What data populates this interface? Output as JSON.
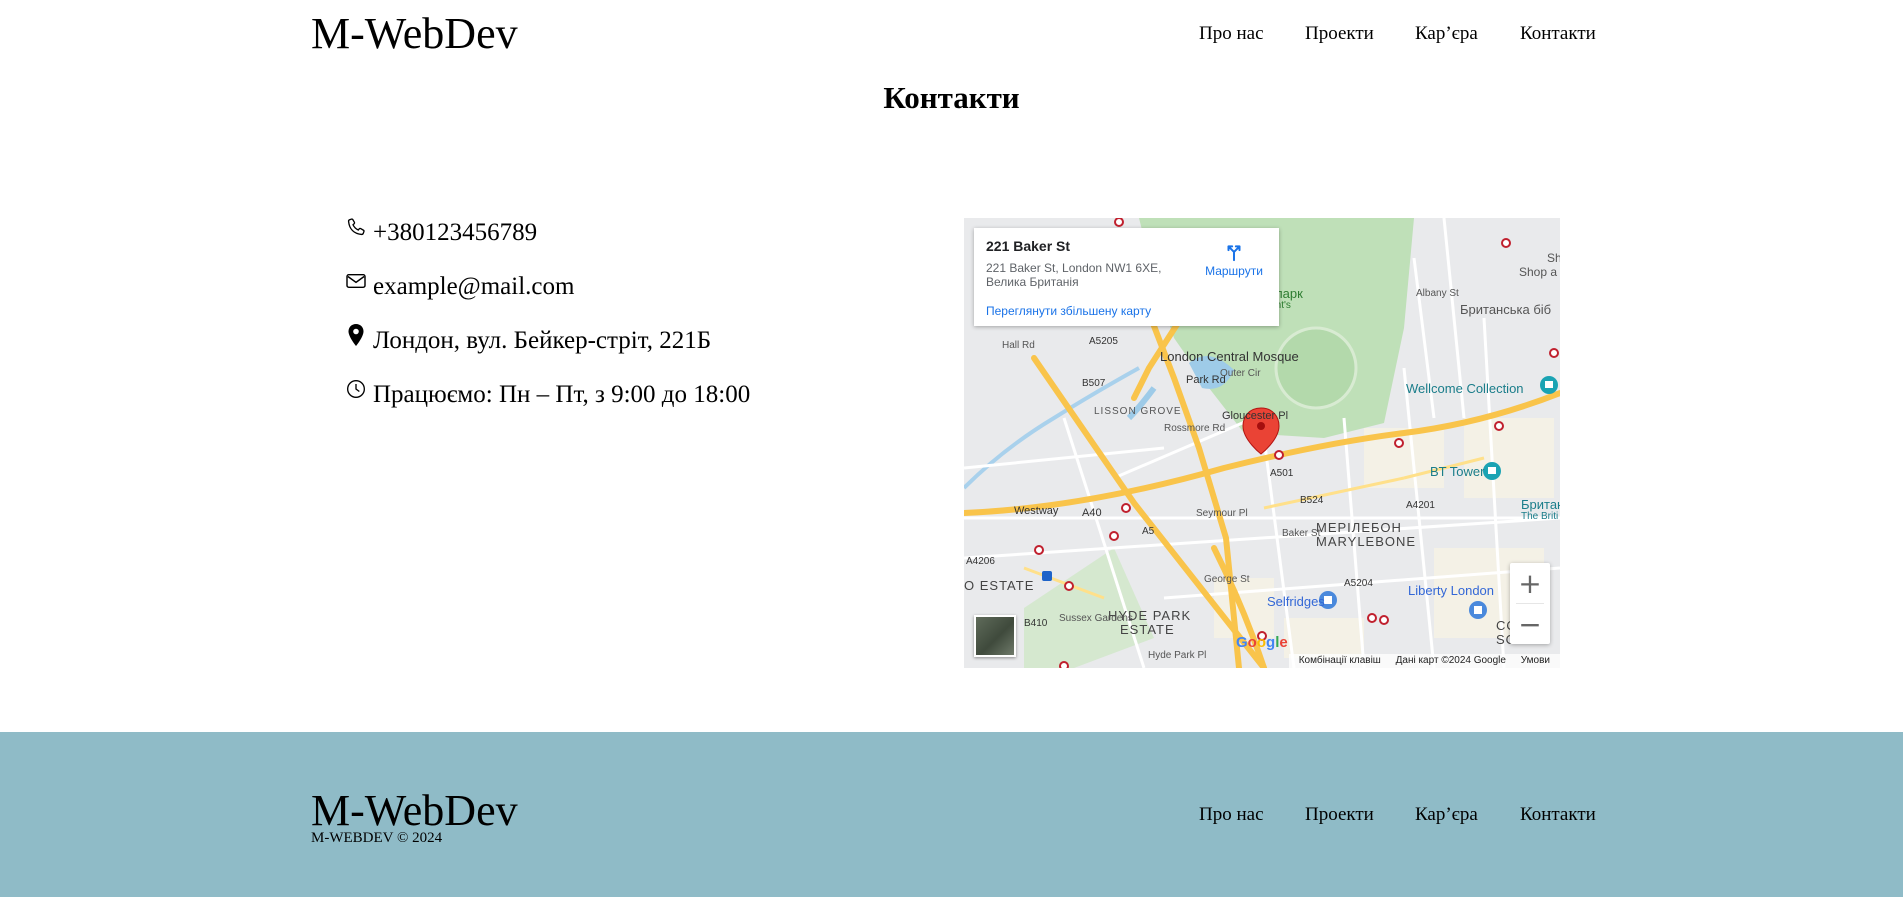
{
  "header": {
    "logo": "M-WebDev",
    "nav": [
      "Про нас",
      "Проекти",
      "Кар’єра",
      "Контакти"
    ]
  },
  "page": {
    "title": "Контакти"
  },
  "contacts": {
    "phone": "+380123456789",
    "email": "example@mail.com",
    "address": "Лондон, вул. Бейкер-стріт, 221Б",
    "hours": "Працюємо: Пн – Пт, з 9:00 до 18:00"
  },
  "map": {
    "card_title": "221 Baker St",
    "card_address": "221 Baker St, London NW1 6XE, Велика Британія",
    "directions_label": "Маршрути",
    "larger_map_link": "Переглянути збільшену карту",
    "zoom_in": "+",
    "zoom_out": "−",
    "google_logo": "Google",
    "shortcuts": "Комбінації клавіш",
    "map_data": "Дані карт ©2024 Google",
    "terms": "Умови",
    "labels": {
      "mosque": "London Central Mosque",
      "park": "тс-парк",
      "park2": "egent's",
      "lisson": "LISSON GROVE",
      "marylebone_uk": "МЕРІЛЕБОН",
      "marylebone": "MARYLEBONE",
      "hyde1": "HYDE PARK",
      "hyde2": "ESTATE",
      "estate": "O ESTATE",
      "wellcome": "Wellcome Collection",
      "bttower": "BT Tower",
      "selfridges": "Selfridges",
      "liberty": "Liberty London",
      "british1": "Британська біб",
      "british2": "Британськ",
      "british3": "The Briti",
      "shop1": "Shop",
      "shop2": "Shop a",
      "westway": "Westway",
      "a40": "A40",
      "a501": "A501",
      "a5205": "A5205",
      "a5": "A5",
      "a4206": "A4206",
      "b507": "B507",
      "b524": "B524",
      "a5204": "A5204",
      "parkrd": "Park Rd",
      "gloucester": "Gloucester Pl",
      "hallrd": "Hall Rd",
      "rossmore": "Rossmore Rd",
      "outercir": "Outer Cir",
      "bakerst": "Baker St",
      "georgest": "George St",
      "sussex": "Sussex Gardens",
      "hydeparkpl": "Hyde Park Pl",
      "albany": "Albany St",
      "seymour": "Seymour Pl",
      "b410": "B410",
      "a4201": "A4201",
      "cosoho1": "CO",
      "cosoho2": "SOHO"
    }
  },
  "footer": {
    "logo": "M-WebDev",
    "copyright": "M-WEBDEV © 2024",
    "nav": [
      "Про нас",
      "Проекти",
      "Кар’єра",
      "Контакти"
    ]
  }
}
